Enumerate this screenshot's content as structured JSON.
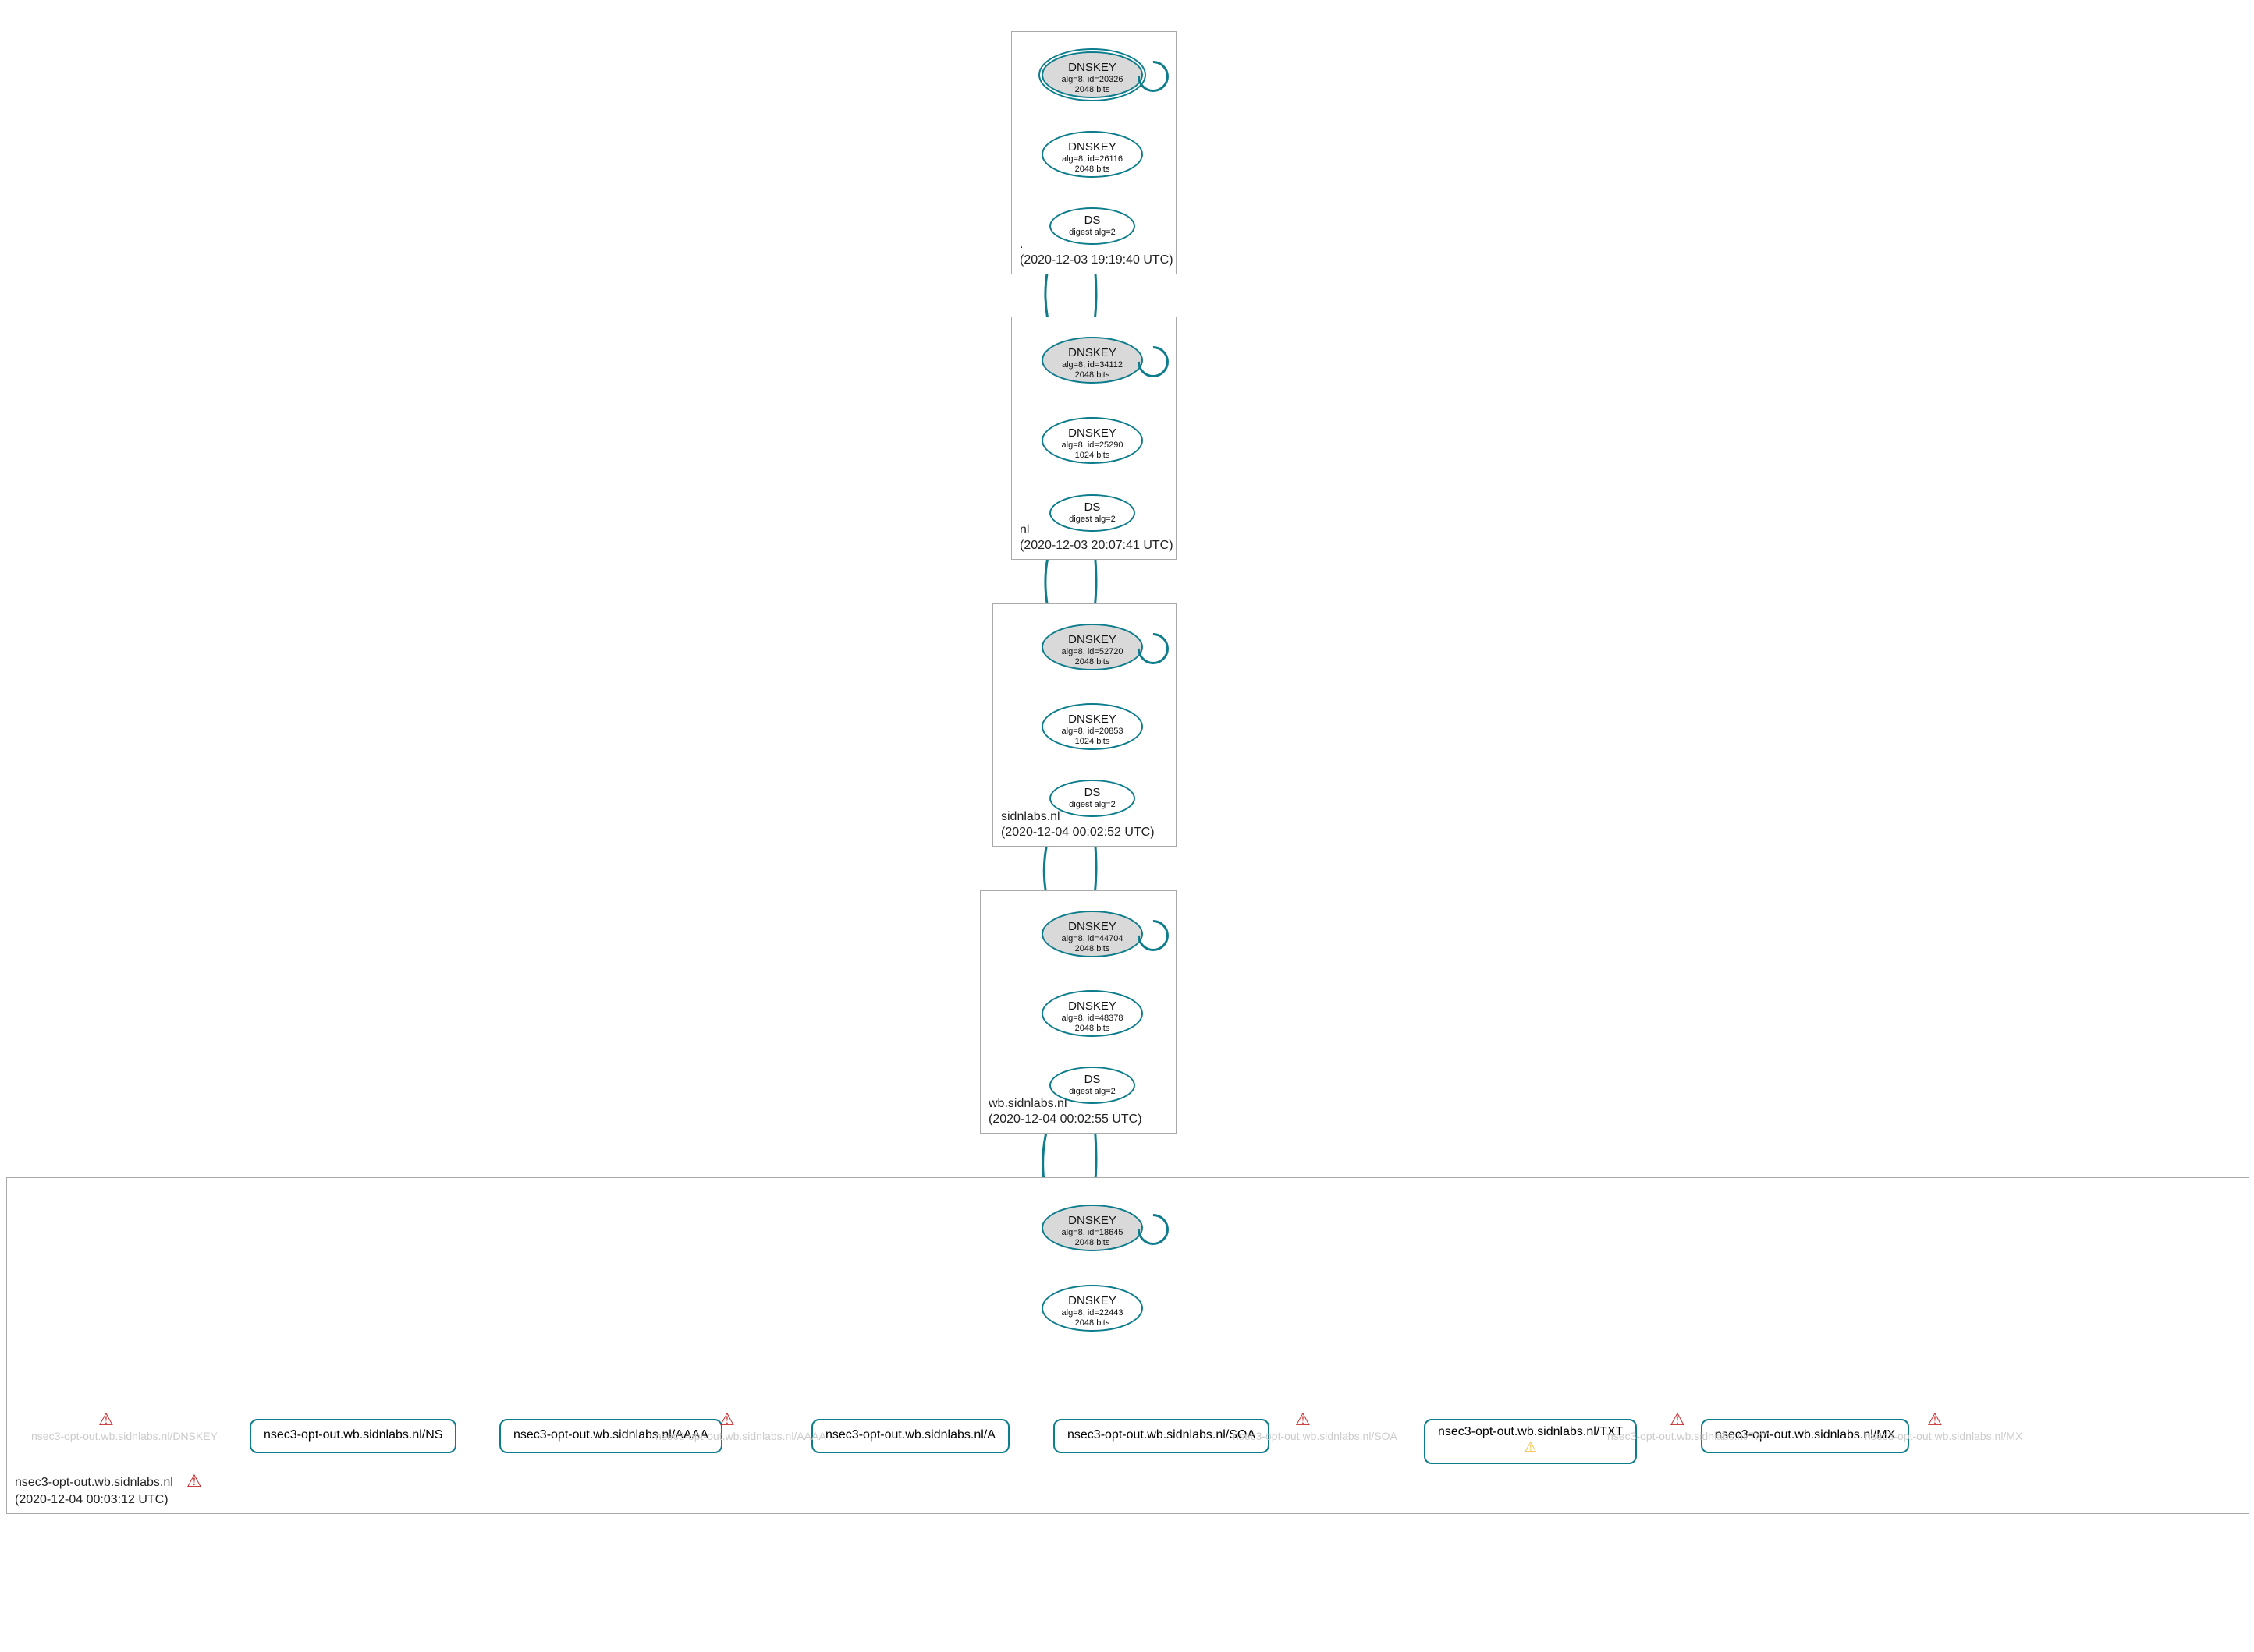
{
  "zones": [
    {
      "id": "root",
      "name": ".",
      "timestamp": "(2020-12-03 19:19:40 UTC)",
      "nodes": [
        {
          "type": "ksk",
          "title": "DNSKEY",
          "sub": "alg=8, id=20326",
          "bits": "2048 bits",
          "root": true
        },
        {
          "type": "zsk",
          "title": "DNSKEY",
          "sub": "alg=8, id=26116",
          "bits": "2048 bits"
        },
        {
          "type": "ds",
          "title": "DS",
          "sub": "digest alg=2"
        }
      ]
    },
    {
      "id": "nl",
      "name": "nl",
      "timestamp": "(2020-12-03 20:07:41 UTC)",
      "nodes": [
        {
          "type": "ksk",
          "title": "DNSKEY",
          "sub": "alg=8, id=34112",
          "bits": "2048 bits"
        },
        {
          "type": "zsk",
          "title": "DNSKEY",
          "sub": "alg=8, id=25290",
          "bits": "1024 bits"
        },
        {
          "type": "ds",
          "title": "DS",
          "sub": "digest alg=2"
        }
      ]
    },
    {
      "id": "sidnlabs",
      "name": "sidnlabs.nl",
      "timestamp": "(2020-12-04 00:02:52 UTC)",
      "nodes": [
        {
          "type": "ksk",
          "title": "DNSKEY",
          "sub": "alg=8, id=52720",
          "bits": "2048 bits"
        },
        {
          "type": "zsk",
          "title": "DNSKEY",
          "sub": "alg=8, id=20853",
          "bits": "1024 bits"
        },
        {
          "type": "ds",
          "title": "DS",
          "sub": "digest alg=2"
        }
      ]
    },
    {
      "id": "wb",
      "name": "wb.sidnlabs.nl",
      "timestamp": "(2020-12-04 00:02:55 UTC)",
      "nodes": [
        {
          "type": "ksk",
          "title": "DNSKEY",
          "sub": "alg=8, id=44704",
          "bits": "2048 bits"
        },
        {
          "type": "zsk",
          "title": "DNSKEY",
          "sub": "alg=8, id=48378",
          "bits": "2048 bits"
        },
        {
          "type": "ds",
          "title": "DS",
          "sub": "digest alg=2"
        }
      ]
    },
    {
      "id": "leaf",
      "name": "nsec3-opt-out.wb.sidnlabs.nl",
      "timestamp": "(2020-12-04 00:03:12 UTC)",
      "error": true,
      "nodes": [
        {
          "type": "ksk",
          "title": "DNSKEY",
          "sub": "alg=8, id=18645",
          "bits": "2048 bits"
        },
        {
          "type": "zsk",
          "title": "DNSKEY",
          "sub": "alg=8, id=22443",
          "bits": "2048 bits"
        }
      ],
      "rrsets": [
        {
          "label": "nsec3-opt-out.wb.sidnlabs.nl/NS"
        },
        {
          "label": "nsec3-opt-out.wb.sidnlabs.nl/AAAA"
        },
        {
          "label": "nsec3-opt-out.wb.sidnlabs.nl/A"
        },
        {
          "label": "nsec3-opt-out.wb.sidnlabs.nl/SOA"
        },
        {
          "label": "nsec3-opt-out.wb.sidnlabs.nl/TXT",
          "warn": true
        },
        {
          "label": "nsec3-opt-out.wb.sidnlabs.nl/MX"
        }
      ],
      "ghosts": [
        {
          "label": "nsec3-opt-out.wb.sidnlabs.nl/DNSKEY"
        },
        {
          "label": "nsec3-opt-out.wb.sidnlabs.nl/AAAA"
        },
        {
          "label": "nsec3-opt-out.wb.sidnlabs.nl/SOA"
        },
        {
          "label": "nsec3-opt-out.wb.sidnlabs.nl/TXT"
        },
        {
          "label": "nsec3-opt-out.wb.sidnlabs.nl/MX"
        }
      ]
    }
  ]
}
